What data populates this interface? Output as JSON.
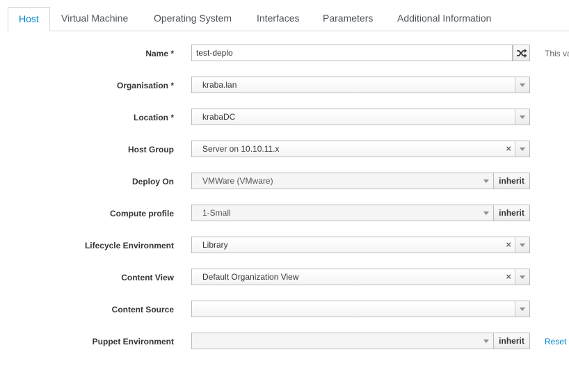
{
  "tabs": [
    {
      "label": "Host"
    },
    {
      "label": "Virtual Machine"
    },
    {
      "label": "Operating System"
    },
    {
      "label": "Interfaces"
    },
    {
      "label": "Parameters"
    },
    {
      "label": "Additional Information"
    }
  ],
  "active_tab": "Host",
  "form": {
    "name": {
      "label": "Name *",
      "value": "test-deplo",
      "help_text": "This va"
    },
    "organisation": {
      "label": "Organisation *",
      "value": "kraba.lan"
    },
    "location": {
      "label": "Location *",
      "value": "krabaDC"
    },
    "host_group": {
      "label": "Host Group",
      "value": "Server on 10.10.11.x"
    },
    "deploy_on": {
      "label": "Deploy On",
      "value": "VMWare (VMware)",
      "inherit_label": "inherit"
    },
    "compute_profile": {
      "label": "Compute profile",
      "value": "1-Small",
      "inherit_label": "inherit"
    },
    "lifecycle_environment": {
      "label": "Lifecycle Environment",
      "value": "Library"
    },
    "content_view": {
      "label": "Content View",
      "value": "Default Organization View"
    },
    "content_source": {
      "label": "Content Source",
      "value": ""
    },
    "puppet_environment": {
      "label": "Puppet Environment",
      "value": "",
      "inherit_label": "inherit",
      "reset_label": "Reset"
    }
  },
  "icons": {
    "clear": "×",
    "shuffle": "shuffle-icon",
    "dropdown": "chevron-down-icon"
  },
  "colors": {
    "accent": "#0088ce",
    "border": "#bbbbbb"
  }
}
